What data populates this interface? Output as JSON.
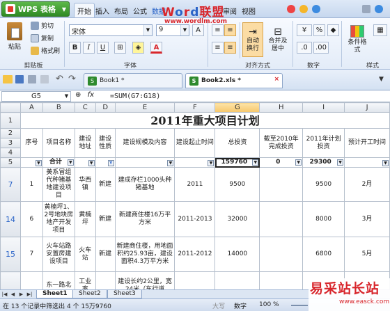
{
  "app": {
    "name": "WPS 表格"
  },
  "watermark": {
    "brand_w": "W",
    "brand_o": "o",
    "brand_r": "r",
    "brand_d": "d",
    "brand_cn": "联盟",
    "url": "www.wordlm.com",
    "bottom_title": "易采站长站",
    "bottom_url": "www.easck.com"
  },
  "menu": [
    "开始",
    "插入",
    "布局",
    "公式",
    "数据",
    "审阅",
    "视图"
  ],
  "ribbon": {
    "paste": "粘贴",
    "cut": "剪切",
    "copy": "复制",
    "format_painter": "格式刷",
    "clipboard_group": "剪贴板",
    "font_name": "宋体",
    "font_size": "9",
    "bold": "B",
    "italic": "I",
    "underline": "U",
    "font_color_letter": "A",
    "font_group": "字体",
    "align_group": "对齐方式",
    "wrap": "自动换行",
    "merge": "合并及居中",
    "number_group": "数字",
    "percent": "%",
    "comma": "◆",
    "cond_format": "条件格式",
    "style_group": "样式"
  },
  "doc_tabs": [
    {
      "name": "Book1 *"
    },
    {
      "name": "Book2.xls *"
    }
  ],
  "formula_bar": {
    "cell_ref": "G5",
    "fx": "fx",
    "formula": "=SUM(G7:G18)"
  },
  "grid": {
    "columns": [
      "A",
      "B",
      "C",
      "D",
      "E",
      "F",
      "G",
      "H",
      "I",
      "J"
    ],
    "rows": [
      "1",
      "2",
      "3",
      "4",
      "5",
      "7",
      "14",
      "15",
      "",
      ""
    ],
    "title": "2011年重大项目计划",
    "headers": [
      "序号",
      "项目名称",
      "建设地址",
      "建设性质",
      "建设规模及内容",
      "建设起止时间",
      "总投资",
      "截至2010年完成投资",
      "2011年计划投资",
      "预计开工时间"
    ],
    "totals": {
      "label": "合计",
      "g": "159760",
      "h": "0",
      "i": "29300"
    },
    "data_rows": [
      {
        "a": "1",
        "b": "美系冒组代种猪基地建设项目",
        "c": "华西镇",
        "d": "新建",
        "e": "建成存栏1000头种猪基地",
        "f": "2011",
        "g": "9500",
        "h": "",
        "i": "9500",
        "j": "2月"
      },
      {
        "a": "6",
        "b": "黄楠坪1、2号地块房地产开发项目",
        "c": "黄楠坪",
        "d": "新建",
        "e": "新建商住楼16万平方米",
        "f": "2011-2013",
        "g": "32000",
        "h": "",
        "i": "8000",
        "j": "3月"
      },
      {
        "a": "7",
        "b": "火车站路安置房建设项目",
        "c": "火车站",
        "d": "新建",
        "e": "新建商住楼，用地面积约25.93亩，建设面积4.3万平方米",
        "f": "2011-2012",
        "g": "14000",
        "h": "",
        "i": "6800",
        "j": "5月"
      },
      {
        "a": "",
        "b": "东一路北",
        "c": "工业率",
        "d": "",
        "e": "建设长约2公里，宽24米（车行道",
        "f": "",
        "g": "",
        "h": "",
        "i": "",
        "j": ""
      }
    ]
  },
  "sheets": [
    "Sheet1",
    "Sheet2",
    "Sheet3"
  ],
  "status": {
    "text": "在 13 个记录中筛选出 4 个  15万9760",
    "caps": "大写",
    "num": "数字",
    "zoom": "100 %"
  }
}
